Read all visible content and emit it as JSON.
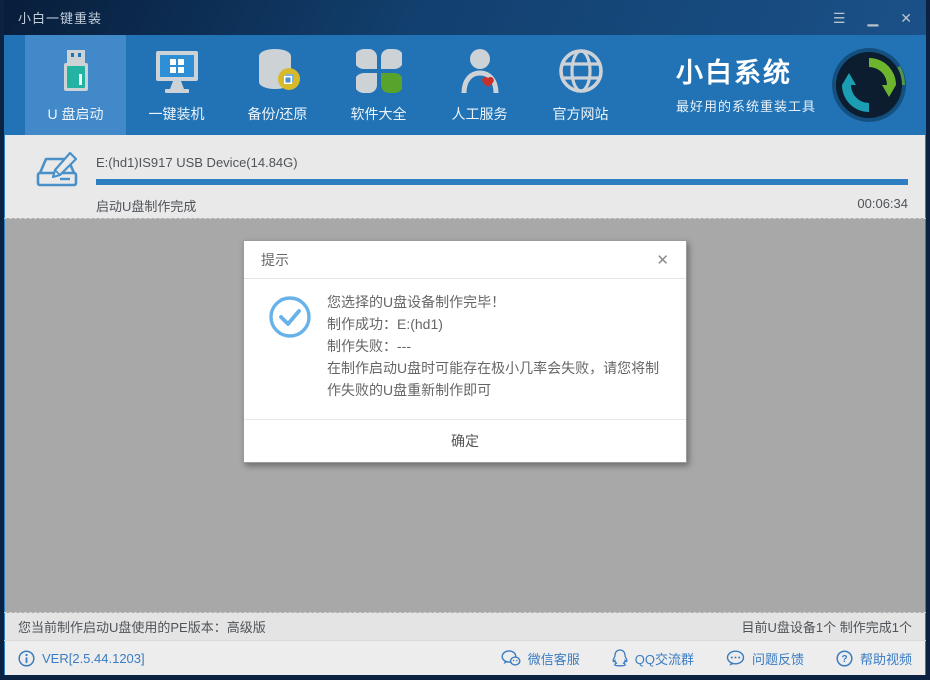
{
  "window": {
    "title": "小白一键重装"
  },
  "titlebar": {
    "menu_icon": "☰",
    "minimize_icon": "▁",
    "close_icon": "✕"
  },
  "nav": {
    "items": [
      {
        "label": "U 盘启动",
        "icon": "usb-drive-icon",
        "active": true
      },
      {
        "label": "一键装机",
        "icon": "monitor-windows-icon",
        "active": false
      },
      {
        "label": "备份/还原",
        "icon": "database-backup-icon",
        "active": false
      },
      {
        "label": "软件大全",
        "icon": "clover-apps-icon",
        "active": false
      },
      {
        "label": "人工服务",
        "icon": "person-heart-icon",
        "active": false
      },
      {
        "label": "官方网站",
        "icon": "globe-icon",
        "active": false
      }
    ],
    "brand": {
      "name": "小白系统",
      "slogan": "最好用的系统重装工具",
      "logo": "refresh-arrows-logo"
    }
  },
  "progress": {
    "device": "E:(hd1)IS917 USB Device(14.84G)",
    "status": "启动U盘制作完成",
    "elapsed": "00:06:34",
    "percent": 100,
    "bar_css": "width:100%"
  },
  "dialog": {
    "title": "提示",
    "close_icon": "✕",
    "lines": [
      "您选择的U盘设备制作完毕！",
      "制作成功：E:(hd1)",
      "制作失败：---",
      "在制作启动U盘时可能存在极小几率会失败，请您将制作失败的U盘重新制作即可"
    ],
    "ok_label": "确定"
  },
  "statusbar": {
    "left": "您当前制作启动U盘使用的PE版本：高级版",
    "right": "目前U盘设备1个 制作完成1个"
  },
  "footer": {
    "version": "VER[2.5.44.1203]",
    "links": [
      {
        "label": "微信客服",
        "icon": "wechat-icon"
      },
      {
        "label": "QQ交流群",
        "icon": "qq-icon"
      },
      {
        "label": "问题反馈",
        "icon": "feedback-bubble-icon"
      },
      {
        "label": "帮助视频",
        "icon": "help-circle-icon"
      }
    ]
  },
  "colors": {
    "nav_bg": "#2173b6",
    "nav_active": "#4189c8",
    "accent_blue": "#2d7fc2",
    "link_blue": "#3a7cc2",
    "main_gray": "#a8a8a8",
    "usb_teal": "#23b3a2",
    "clover_green": "#57a32c",
    "heart_red": "#c9302c",
    "badge_yellow": "#d8b92a"
  }
}
